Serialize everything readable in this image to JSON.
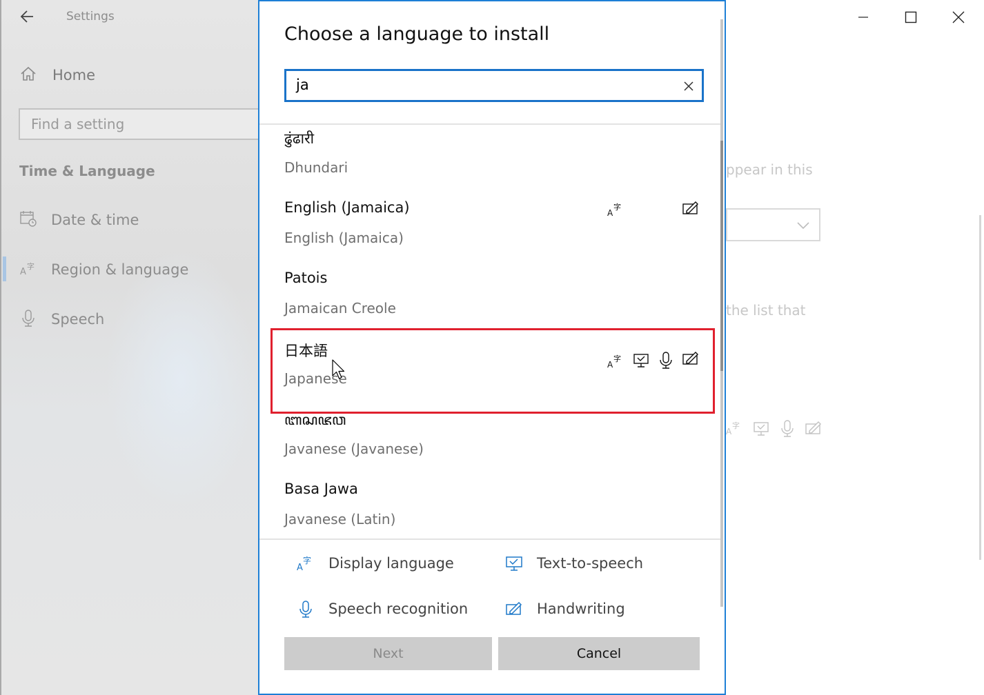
{
  "window": {
    "app_title": "Settings",
    "back_icon": "back-arrow-icon",
    "controls": [
      "minimize-icon",
      "maximize-icon",
      "close-icon"
    ]
  },
  "sidebar": {
    "home_label": "Home",
    "search_placeholder": "Find a setting",
    "section_title": "Time & Language",
    "items": [
      {
        "label": "Date & time",
        "icon": "calendar-clock-icon"
      },
      {
        "label": "Region & language",
        "icon": "language-icon",
        "selected": true
      },
      {
        "label": "Speech",
        "icon": "microphone-icon"
      }
    ]
  },
  "background_main": {
    "text_1": "ppear in this",
    "text_2": "the list that"
  },
  "dialog": {
    "title": "Choose a language to install",
    "search_value": "ja",
    "languages": [
      {
        "native": "ढुंढारी",
        "english": "Dhundari",
        "features": []
      },
      {
        "native": "English (Jamaica)",
        "english": "English (Jamaica)",
        "features": [
          "display",
          "handwriting"
        ]
      },
      {
        "native": "Patois",
        "english": "Jamaican Creole",
        "features": []
      },
      {
        "native": "日本語",
        "english": "Japanese",
        "features": [
          "display",
          "tts",
          "speech",
          "handwriting"
        ],
        "highlighted": true
      },
      {
        "native": "ꦧꦱꦗꦮ",
        "english": "Javanese (Javanese)",
        "features": []
      },
      {
        "native": "Basa Jawa",
        "english": "Javanese (Latin)",
        "features": []
      }
    ],
    "legend": {
      "display": "Display language",
      "tts": "Text-to-speech",
      "speech": "Speech recognition",
      "handwriting": "Handwriting"
    },
    "buttons": {
      "next": "Next",
      "cancel": "Cancel"
    }
  },
  "colors": {
    "accent": "#1a73c9",
    "highlight": "#e0202e",
    "icon_blue": "#1e78c8"
  }
}
